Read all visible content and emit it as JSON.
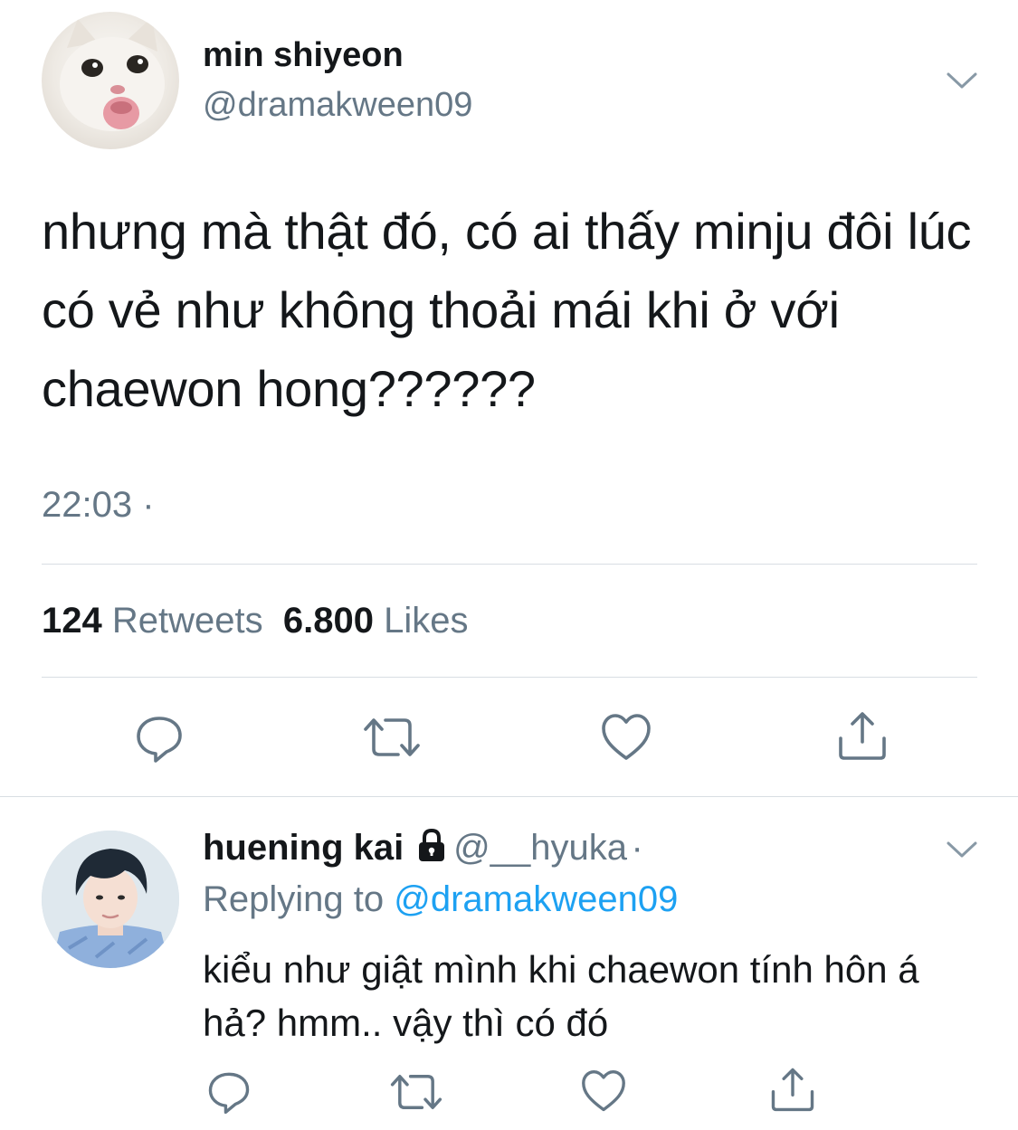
{
  "tweet": {
    "author": {
      "name": "min shiyeon",
      "handle": "@dramakween09",
      "avatar": "cat-avatar"
    },
    "text": "nhưng mà thật đó, có ai thấy minju đôi lúc có vẻ như không thoải mái khi ở với chaewon hong??????",
    "time": "22:03 ·",
    "retweets_count": "124",
    "retweets_label": "Retweets",
    "likes_count": "6.800",
    "likes_label": "Likes",
    "actions": [
      "reply-icon",
      "retweet-icon",
      "like-icon",
      "share-icon"
    ]
  },
  "reply": {
    "author": {
      "name": "huening kai",
      "handle": "@__hyuka",
      "separator": "·",
      "locked": true,
      "avatar": "person-avatar"
    },
    "replying_to_label": "Replying to",
    "replying_to_handle": "@dramakween09",
    "text": "kiểu như giật mình khi chaewon tính hôn á hả? hmm.. vậy thì có đó",
    "actions": [
      "reply-icon",
      "retweet-icon",
      "like-icon",
      "share-icon"
    ]
  },
  "colors": {
    "text": "#14171a",
    "secondary": "#657786",
    "link": "#1da1f2",
    "divider": "#d8dee3"
  }
}
